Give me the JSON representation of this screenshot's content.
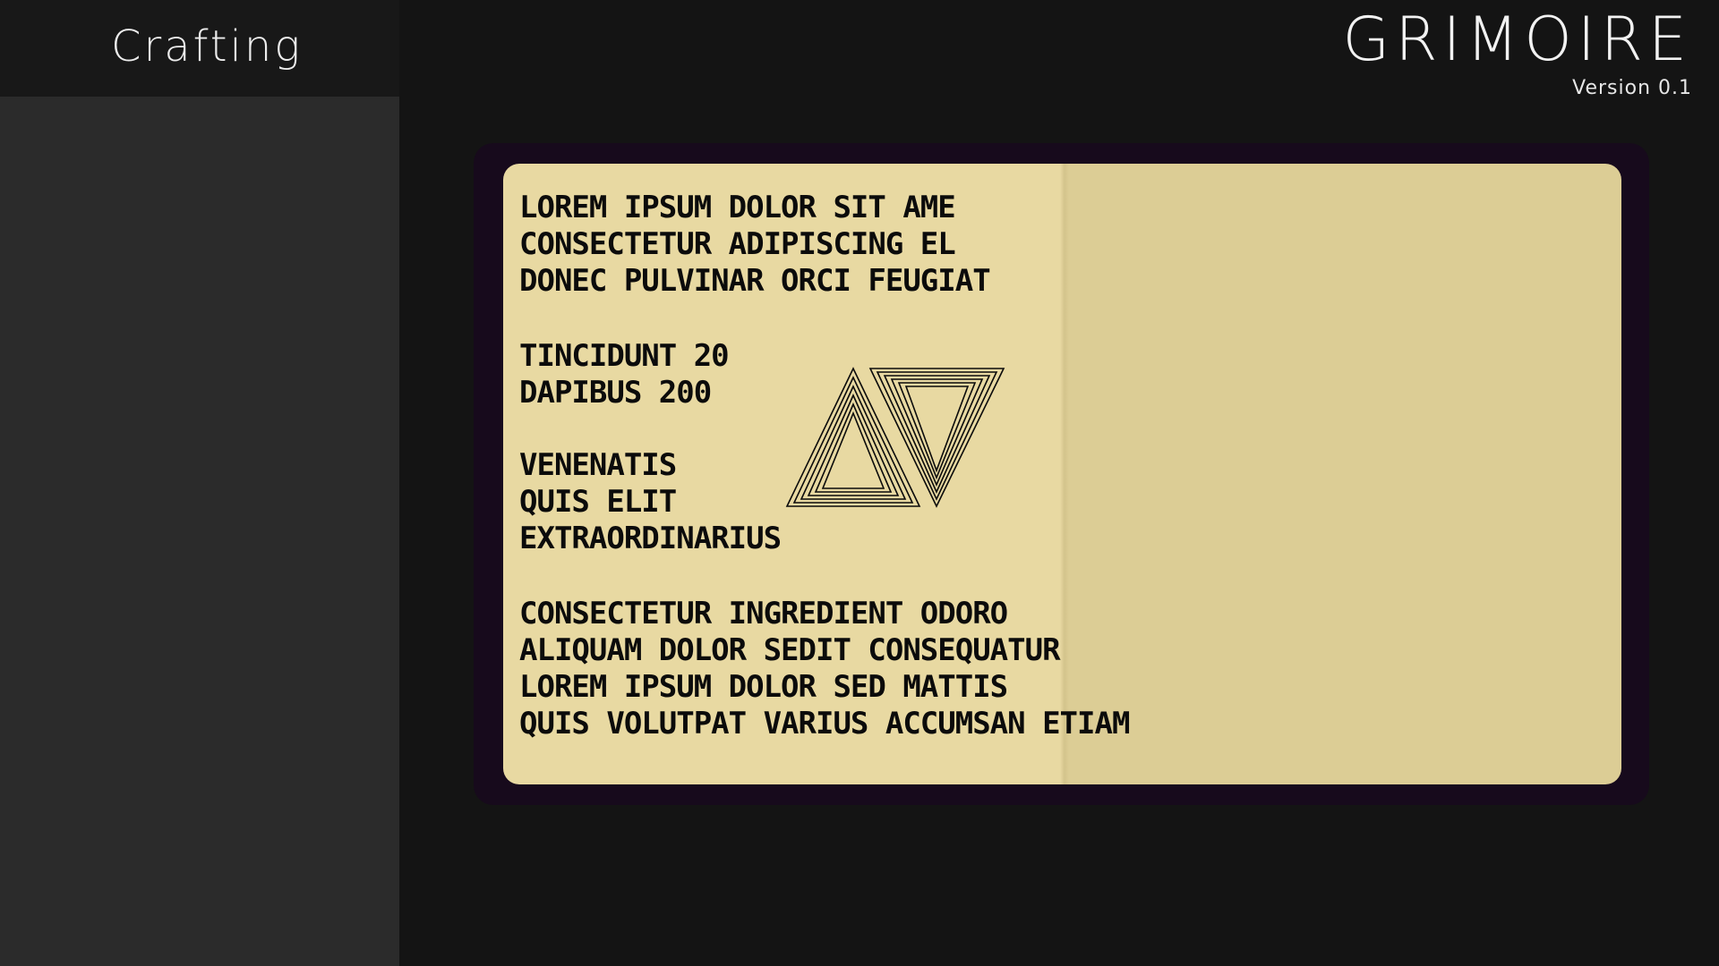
{
  "sidebar": {
    "title": "Crafting"
  },
  "brand": {
    "title": "GRIMOIRE",
    "version": "Version 0.1"
  },
  "book": {
    "intro_lines": [
      "LOREM IPSUM DOLOR SIT AME",
      "CONSECTETUR ADIPISCING EL",
      "DONEC PULVINAR ORCI FEUGIAT"
    ],
    "stats_lines": [
      "TINCIDUNT 20",
      "DAPIBUS 200"
    ],
    "ingredients_lines": [
      "VENENATIS",
      "QUIS ELIT",
      "EXTRAORDINARIUS"
    ],
    "description_lines": [
      "CONSECTETUR INGREDIENT ODORO",
      "ALIQUAM DOLOR SEDIT CONSEQUATUR",
      "LOREM IPSUM DOLOR SED MATTIS",
      "QUIS VOLUTPAT VARIUS ACCUMSAN ETIAM"
    ],
    "glyph_icon": "crafting-sigil-icon",
    "colors": {
      "page_left": "#e8d9a2",
      "page_right": "#dccd95",
      "cover": "#170a1c",
      "ink": "#0b0b0b"
    }
  }
}
